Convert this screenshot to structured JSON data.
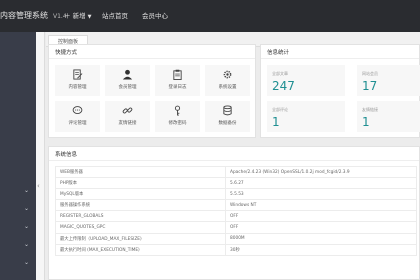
{
  "header": {
    "brand": "内容管理系统",
    "version": "V1.4",
    "nav": [
      {
        "label": "新增",
        "has_dropdown": true
      },
      {
        "label": "站点首页",
        "has_dropdown": false
      },
      {
        "label": "会员中心",
        "has_dropdown": false
      }
    ]
  },
  "tabs": [
    {
      "label": "控制面板"
    }
  ],
  "quick_actions": {
    "title": "快捷方式",
    "items": [
      {
        "label": "内容管理",
        "icon": "edit-doc-icon"
      },
      {
        "label": "会员管理",
        "icon": "user-icon"
      },
      {
        "label": "登录日志",
        "icon": "clipboard-icon"
      },
      {
        "label": "系统设置",
        "icon": "gear-icon"
      },
      {
        "label": "评论管理",
        "icon": "comment-icon"
      },
      {
        "label": "友情链接",
        "icon": "link-icon"
      },
      {
        "label": "修改密码",
        "icon": "key-icon"
      },
      {
        "label": "数据备份",
        "icon": "database-icon"
      }
    ]
  },
  "stats": {
    "title": "信息统计",
    "items": [
      {
        "label": "全部文章",
        "value": "247"
      },
      {
        "label": "网站会员",
        "value": "17"
      },
      {
        "label": "全部评论",
        "value": "1"
      },
      {
        "label": "友情链接",
        "value": "1"
      }
    ]
  },
  "system_info": {
    "title": "系统信息",
    "rows": [
      {
        "key": "WEB服务器",
        "value": "Apache/2.4.23 (Win32) OpenSSL/1.0.2j mod_fcgid/2.3.9"
      },
      {
        "key": "PHP版本",
        "value": "5.6.27"
      },
      {
        "key": "MySQL版本",
        "value": "5.5.53"
      },
      {
        "key": "服务器操作系统",
        "value": "Windows NT"
      },
      {
        "key": "REGISTER_GLOBALS",
        "value": "OFF"
      },
      {
        "key": "MAGIC_QUOTES_GPC",
        "value": "OFF"
      },
      {
        "key": "最大上传限制（UPLOAD_MAX_FILESIZE)",
        "value": "8000M"
      },
      {
        "key": "最大执行时间 (MAX_EXECUTION_TIME)",
        "value": "30秒"
      }
    ]
  },
  "colors": {
    "topbar": "#2a2c30",
    "sidebar": "#393d49",
    "stat_value": "#1f8f92",
    "icon": "#444444"
  }
}
